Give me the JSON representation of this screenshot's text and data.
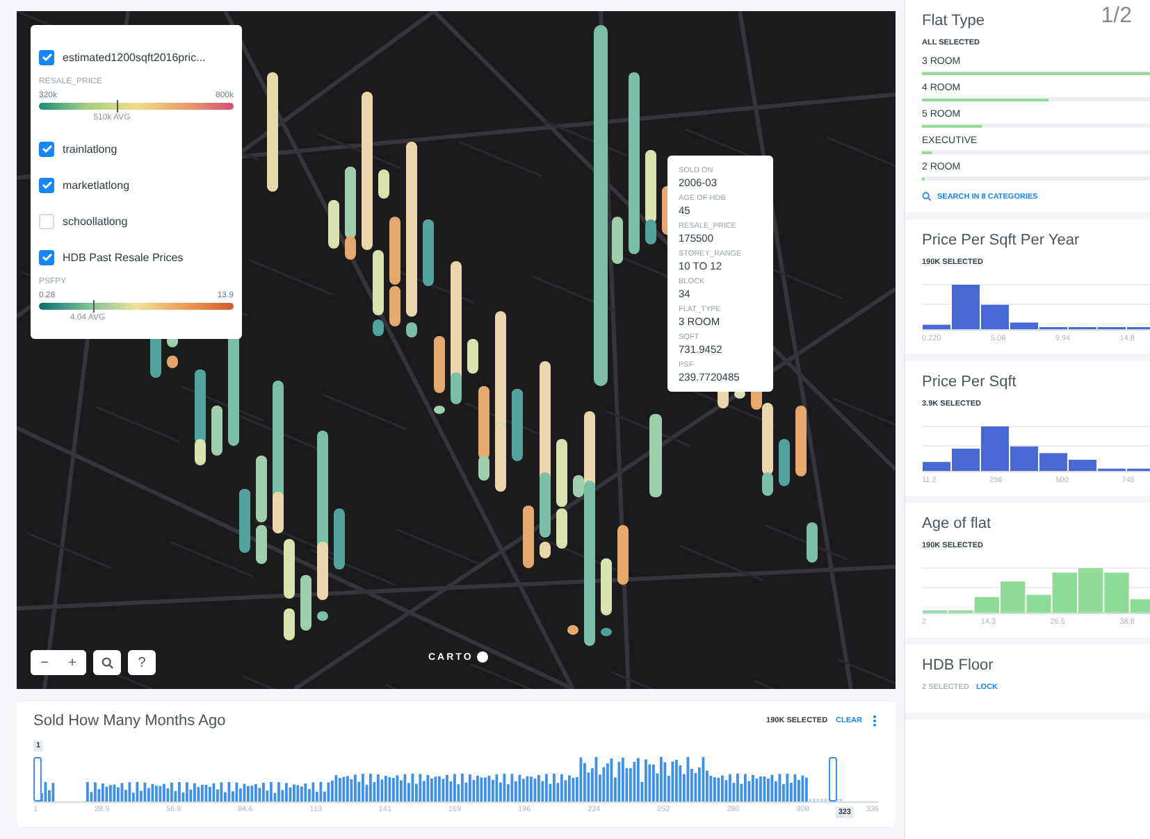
{
  "page_indicator": "1/2",
  "map": {
    "layers": [
      {
        "label": "estimated1200sqft2016pric...",
        "checked": true,
        "legend": {
          "field": "RESALE_PRICE",
          "min": "320k",
          "max": "800k",
          "avg": "510k AVG",
          "level": 0.4,
          "kind": "price"
        }
      },
      {
        "label": "trainlatlong",
        "checked": true
      },
      {
        "label": "marketlatlong",
        "checked": true
      },
      {
        "label": "schoollatlong",
        "checked": false
      },
      {
        "label": "HDB Past Resale Prices",
        "checked": true,
        "legend": {
          "field": "PSFPY",
          "min": "0.28",
          "max": "13.9",
          "avg": "4.04 AVG",
          "level": 0.28,
          "kind": "psf"
        }
      }
    ],
    "tooltip": [
      {
        "label": "SOLD ON",
        "value": "2006-03"
      },
      {
        "label": "AGE OF HDB",
        "value": "45"
      },
      {
        "label": "RESALE_PRICE",
        "value": "175500"
      },
      {
        "label": "STOREY_RANGE",
        "value": "10 TO 12"
      },
      {
        "label": "BLOCK",
        "value": "34"
      },
      {
        "label": "FLAT_TYPE",
        "value": "3 ROOM"
      },
      {
        "label": "SQFT",
        "value": "731.9452"
      },
      {
        "label": "PSF",
        "value": "239.7720485"
      }
    ],
    "controls": [
      "−",
      "+",
      "?"
    ],
    "attribution": "CARTO"
  },
  "timeline": {
    "title": "Sold How Many Months Ago",
    "selected": "190K SELECTED",
    "clear": "CLEAR",
    "range_start": "1",
    "range_end": "323",
    "ticks": [
      "1",
      "28.9",
      "56.8",
      "84.6",
      "113",
      "141",
      "169",
      "196",
      "224",
      "252",
      "280",
      "308",
      "336"
    ]
  },
  "sidebar": {
    "widgets": [
      {
        "kind": "category",
        "title": "Flat Type",
        "subtitle": "ALL SELECTED",
        "items": [
          {
            "label": "3 ROOM",
            "level": 1
          },
          {
            "label": "4 ROOM",
            "level": 0.55
          },
          {
            "label": "5 ROOM",
            "level": 0.26
          },
          {
            "label": "EXECUTIVE",
            "level": 0.04
          },
          {
            "label": "2 ROOM",
            "level": 0.01
          }
        ],
        "search": "SEARCH IN 8 CATEGORIES"
      },
      {
        "kind": "histogram",
        "title": "Price Per Sqft Per Year",
        "subtitle": "190K SELECTED",
        "color": "#4a67d6",
        "ticks": [
          "0.220",
          "5.08",
          "9.94",
          "14.8"
        ]
      },
      {
        "kind": "histogram",
        "title": "Price Per Sqft",
        "subtitle": "3.9K SELECTED",
        "color": "#4a67d6",
        "ticks": [
          "11.2",
          "256",
          "500",
          "745"
        ]
      },
      {
        "kind": "histogram",
        "title": "Age of flat",
        "subtitle": "190K SELECTED",
        "color": "#8fdc98",
        "ticks": [
          "2",
          "14.3",
          "26.5",
          "38.8"
        ]
      },
      {
        "kind": "range",
        "title": "HDB Floor",
        "subtitle": "2 SELECTED",
        "link": "LOCK"
      }
    ]
  }
}
